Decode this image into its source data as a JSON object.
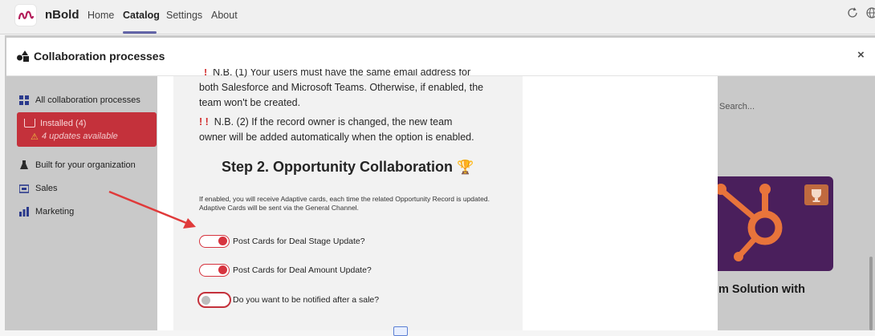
{
  "app": {
    "name": "nBold"
  },
  "nav": {
    "home": "Home",
    "catalog": "Catalog",
    "settings": "Settings",
    "about": "About"
  },
  "topIcons": [
    "refresh-icon",
    "globe-icon"
  ],
  "sidebar": {
    "items": [
      {
        "label": "All collaboration processes",
        "icon": "grid-icon"
      },
      {
        "label": "Installed (4)",
        "sub": "4 updates available",
        "icon": "tray-icon",
        "active": true
      },
      {
        "label": "Built for your organization",
        "icon": "flask-icon"
      },
      {
        "label": "Sales",
        "icon": "sales-icon"
      },
      {
        "label": "Marketing",
        "icon": "bar-chart-icon"
      }
    ]
  },
  "right": {
    "searchPlaceholder": "Search...",
    "cardTitle": "m Solution with"
  },
  "modal": {
    "title": "Collaboration processes",
    "close": "×",
    "note1": {
      "bangs": "!",
      "text": "N.B. (1) Your users must have the same email address for",
      "line2": "both Salesforce and Microsoft Teams. Otherwise, if enabled, the",
      "line3": "team won't be created."
    },
    "note2": {
      "bangs": "! !",
      "text": "N.B. (2) If the record owner is changed, the new team",
      "line2": "owner will be added automatically when the option is enabled."
    },
    "step": {
      "title": "Step 2. Opportunity Collaboration",
      "trophy": "🏆"
    },
    "description": "If enabled, you will receive Adaptive cards, each time the related Opportunity Record is updated. Adaptive Cards will be sent via the General Channel.",
    "toggles": [
      {
        "label": "Post Cards for Deal Stage Update?",
        "on": true
      },
      {
        "label": "Post Cards for Deal Amount Update?",
        "on": true
      },
      {
        "label": "Do you want to be notified after a sale?",
        "on": false
      }
    ]
  },
  "colors": {
    "accent": "#6264a7",
    "danger": "#c4313b",
    "hubspot": "#e8743b",
    "cardBg": "#4a1f5c"
  }
}
